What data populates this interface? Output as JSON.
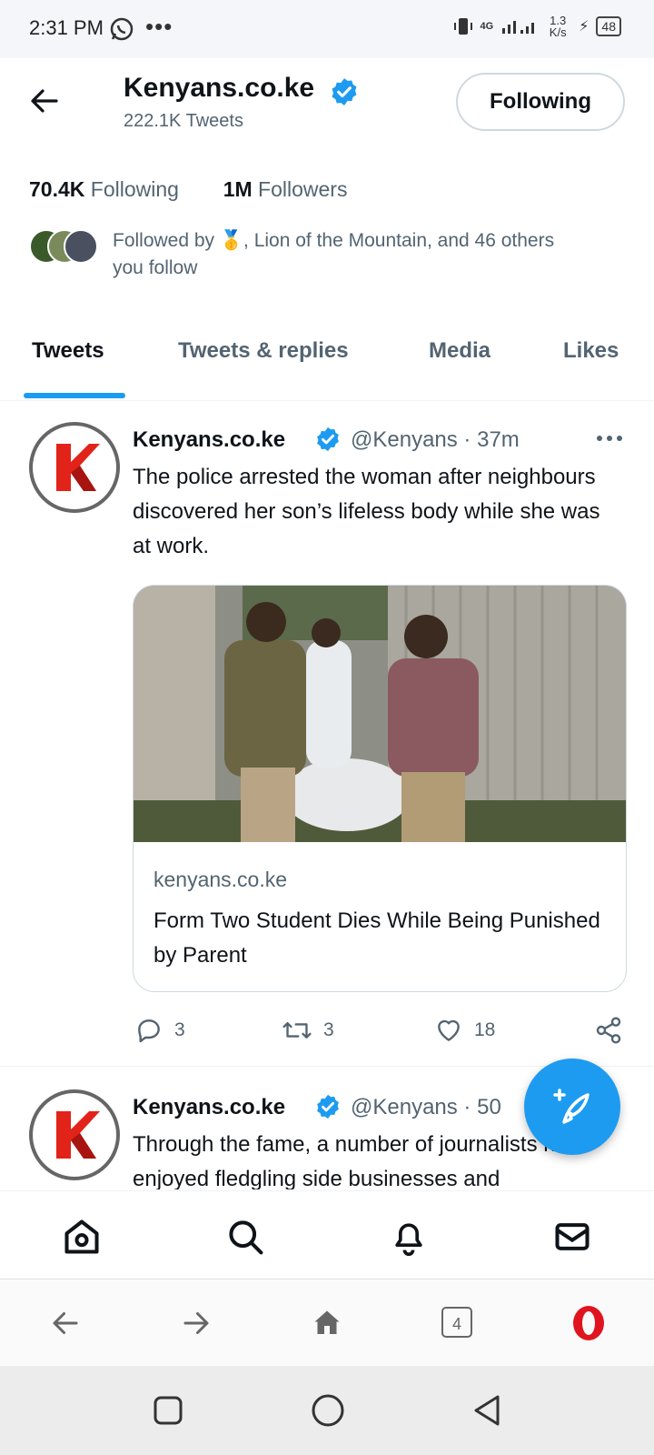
{
  "status_bar": {
    "time": "2:31 PM",
    "dots": "•••",
    "net_speed": "1.3 K/s",
    "battery": "48",
    "signal": "4G"
  },
  "header": {
    "name": "Kenyans.co.ke",
    "tweets_count": "222.1K Tweets",
    "follow_button": "Following"
  },
  "profile": {
    "following_count": "70.4K",
    "following_label": "Following",
    "followers_count": "1M",
    "followers_label": "Followers",
    "followed_by": "Followed by 🥇, Lion of the Mountain, and 46 others you follow"
  },
  "tabs": [
    {
      "label": "Tweets"
    },
    {
      "label": "Tweets & replies"
    },
    {
      "label": "Media"
    },
    {
      "label": "Likes"
    }
  ],
  "tweets": [
    {
      "name": "Kenyans.co.ke",
      "handle": "@Kenyans · 37m",
      "text": "The police arrested the woman after neighbours discovered her son’s lifeless body while she was at work.",
      "card": {
        "domain": "kenyans.co.ke",
        "title": "Form Two Student Dies While Being Punished by Parent"
      },
      "replies": "3",
      "retweets": "3",
      "likes": "18"
    },
    {
      "name": "Kenyans.co.ke",
      "handle": "@Kenyans · 50",
      "text": "Through the fame, a number of journalists have enjoyed fledgling side businesses and"
    }
  ],
  "browser": {
    "tab_count": "4"
  },
  "colors": {
    "accent": "#1d9bf0",
    "opera_red": "#e0141e",
    "logo_red": "#e2231a"
  }
}
